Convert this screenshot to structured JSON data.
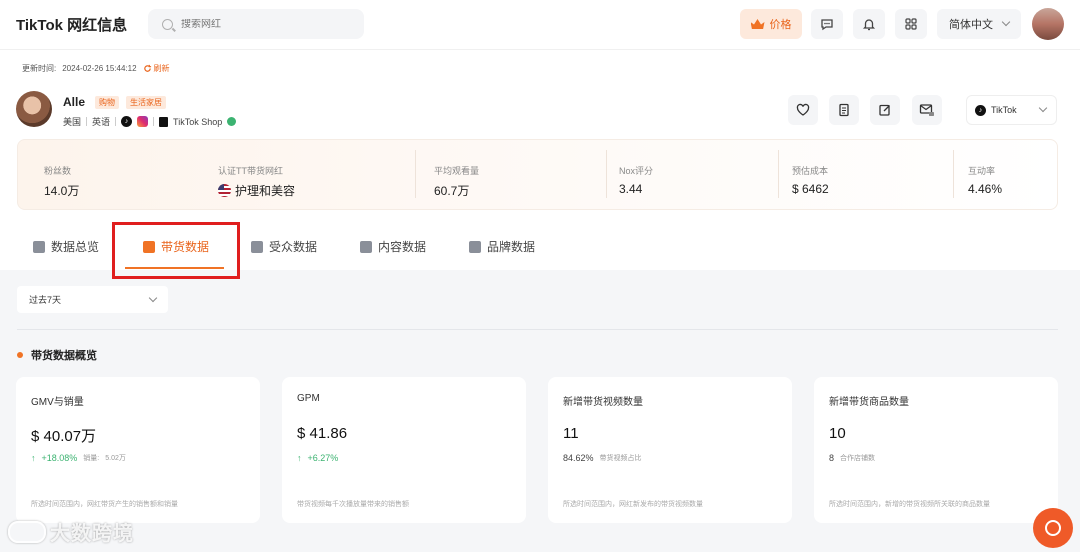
{
  "header": {
    "brand": "TikTok 网红信息",
    "search_placeholder": "搜索网红",
    "price_label": "价格",
    "language": "简体中文"
  },
  "update": {
    "label": "更新时间:",
    "time": "2024-02-26 15:44:12",
    "refresh": "刷新"
  },
  "profile": {
    "name": "Alle",
    "tags": [
      "购物",
      "生活家居"
    ],
    "country": "美国",
    "language": "英语",
    "shop_label": "TikTok Shop",
    "platform": "TikTok"
  },
  "stats": [
    {
      "label": "粉丝数",
      "value": "14.0万"
    },
    {
      "label": "认证TT带货网红",
      "value": "护理和美容"
    },
    {
      "label": "平均观看量",
      "value": "60.7万"
    },
    {
      "label": "Nox评分",
      "value": "3.44"
    },
    {
      "label": "预估成本",
      "value": "$ 6462"
    },
    {
      "label": "互动率",
      "value": "4.46%"
    }
  ],
  "tabs": [
    {
      "label": "数据总览"
    },
    {
      "label": "带货数据"
    },
    {
      "label": "受众数据"
    },
    {
      "label": "内容数据"
    },
    {
      "label": "品牌数据"
    }
  ],
  "period": "过去7天",
  "section_title": "带货数据概览",
  "cards": [
    {
      "title": "GMV与销量",
      "value": "$ 40.07万",
      "change": "+18.08%",
      "sub_label": "销量:",
      "sub_value": "5.02万",
      "footer": "所选时间范围内，网红带货产生的销售额和销量"
    },
    {
      "title": "GPM",
      "value": "$ 41.86",
      "change": "+6.27%",
      "footer": "带货视频每千次播放量带来的销售额"
    },
    {
      "title": "新增带货视频数量",
      "value": "11",
      "ratio": "84.62%",
      "ratio_label": "带货视频占比",
      "footer": "所选时间范围内，网红新发布的带货视频数量"
    },
    {
      "title": "新增带货商品数量",
      "value": "10",
      "count": "8",
      "count_label": "合作店铺数",
      "footer": "所选时间范围内，新增的带货视频所关联的商品数量"
    }
  ],
  "watermark": "大数跨境"
}
